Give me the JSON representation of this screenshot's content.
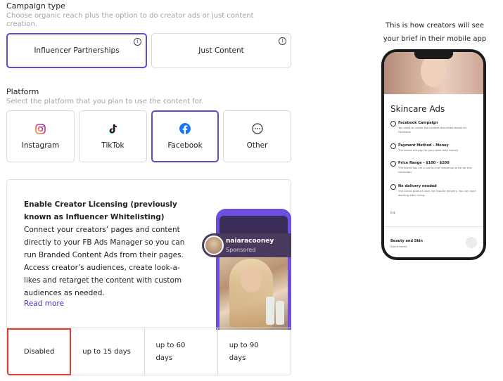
{
  "campaign_type": {
    "label": "Campaign type",
    "sub": "Choose organic reach plus the option to do creator ads or just content creation.",
    "options": [
      {
        "label": "Influencer Partnerships",
        "selected": true,
        "info_icon": "info-icon"
      },
      {
        "label": "Just Content",
        "selected": false,
        "info_icon": "info-icon"
      }
    ]
  },
  "platform": {
    "label": "Platform",
    "sub": "Select the platform that you plan to use the content for.",
    "options": [
      {
        "label": "Instagram",
        "icon": "instagram-icon",
        "selected": false
      },
      {
        "label": "TikTok",
        "icon": "tiktok-icon",
        "selected": false
      },
      {
        "label": "Facebook",
        "icon": "facebook-icon",
        "selected": true
      },
      {
        "label": "Other",
        "icon": "ellipsis-icon",
        "selected": false
      }
    ]
  },
  "licensing": {
    "title": "Enable Creator Licensing (previously known as Influencer Whitelisting)",
    "description": "Connect your creators’ pages and content directly to your FB Ads Manager so you can run Branded Content Ads from their pages. Access creator’s audiences, create look-a-likes and retarget the content with custom audiences as needed.",
    "read_more": "Read more",
    "preview": {
      "account": "naiaracooney",
      "tag": "Sponsored"
    },
    "durations": [
      "Disabled",
      "up to 15 days",
      "up to 60 days",
      "up to 90 days"
    ],
    "selected_duration": "Disabled"
  },
  "preview_panel": {
    "caption": "This is how creators will see your brief in their mobile app",
    "brief_title": "Skincare Ads",
    "items": [
      {
        "title": "Facebook Campaign",
        "desc": "You need to create the content described below for Facebook"
      },
      {
        "title": "Payment Method - Money",
        "desc": "The brand will pay for your work with money"
      },
      {
        "title": "Price Range - $100 - $200",
        "desc": "The brand has set a cap on the maximum price for this campaign"
      },
      {
        "title": "No delivery needed",
        "desc": "The brand product does not require delivery. You can start working after hiring."
      }
    ],
    "misc": "link",
    "category": "Beauty and Skin",
    "category_sub": "About brand"
  },
  "colors": {
    "accent": "#5a4fcf",
    "danger": "#e53935",
    "link": "#3d36c9"
  }
}
